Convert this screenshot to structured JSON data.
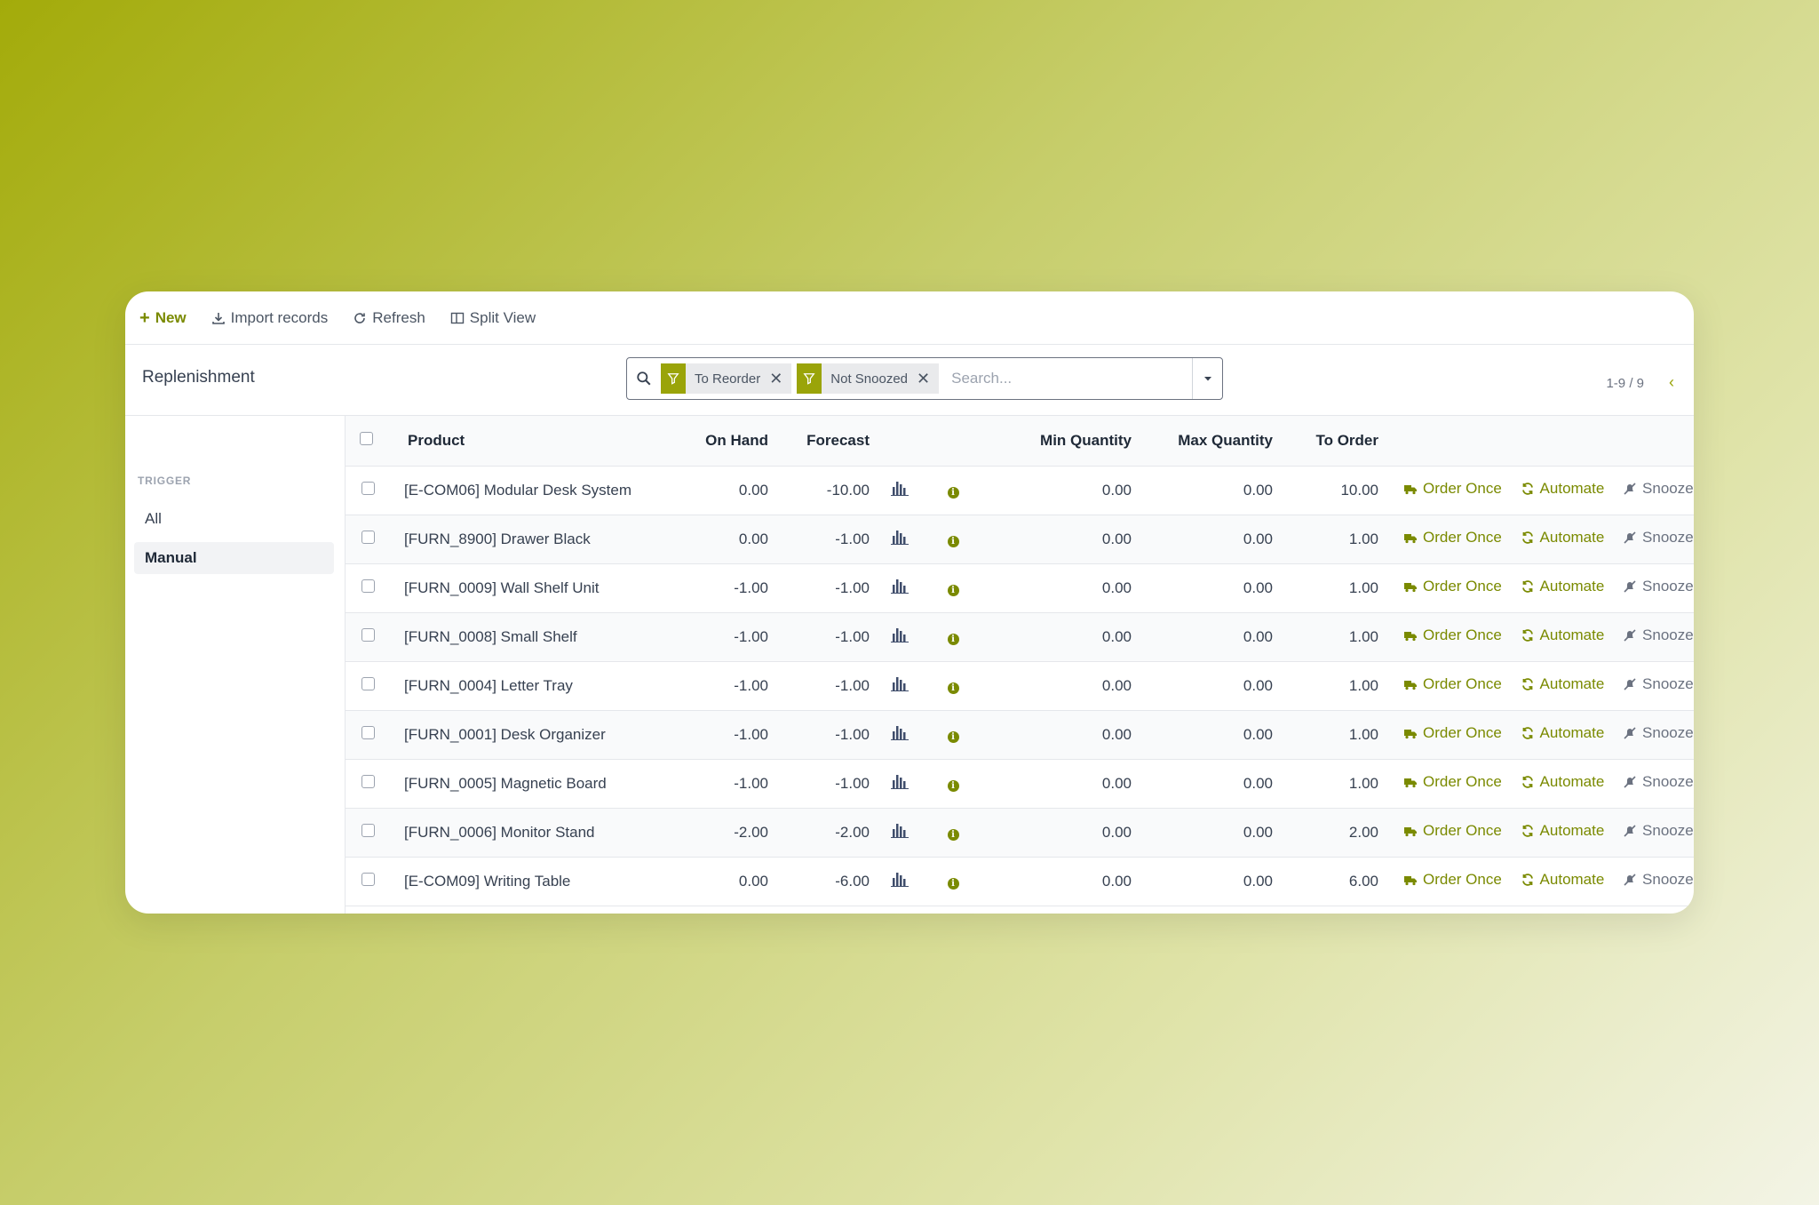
{
  "colors": {
    "accent": "#7a8a00",
    "facet": "#9aa409"
  },
  "toolbar": {
    "new_label": "New",
    "import_label": "Import records",
    "refresh_label": "Refresh",
    "split_label": "Split View"
  },
  "breadcrumb": "Replenishment",
  "search": {
    "facets": [
      "To Reorder",
      "Not Snoozed"
    ],
    "placeholder": "Search..."
  },
  "pager": "1-9 / 9",
  "sidebar": {
    "title": "TRIGGER",
    "items": [
      {
        "label": "All",
        "active": false
      },
      {
        "label": "Manual",
        "active": true
      }
    ]
  },
  "table": {
    "headers": {
      "product": "Product",
      "on_hand": "On Hand",
      "forecast": "Forecast",
      "min_qty": "Min Quantity",
      "max_qty": "Max Quantity",
      "to_order": "To Order"
    },
    "actions": {
      "order_once": "Order Once",
      "automate": "Automate",
      "snooze": "Snooze"
    },
    "rows": [
      {
        "product": "[E-COM06] Modular Desk System",
        "on_hand": "0.00",
        "forecast": "-10.00",
        "min": "0.00",
        "max": "0.00",
        "to_order": "10.00"
      },
      {
        "product": "[FURN_8900] Drawer Black",
        "on_hand": "0.00",
        "forecast": "-1.00",
        "min": "0.00",
        "max": "0.00",
        "to_order": "1.00"
      },
      {
        "product": "[FURN_0009] Wall Shelf Unit",
        "on_hand": "-1.00",
        "forecast": "-1.00",
        "min": "0.00",
        "max": "0.00",
        "to_order": "1.00"
      },
      {
        "product": "[FURN_0008] Small Shelf",
        "on_hand": "-1.00",
        "forecast": "-1.00",
        "min": "0.00",
        "max": "0.00",
        "to_order": "1.00"
      },
      {
        "product": "[FURN_0004] Letter Tray",
        "on_hand": "-1.00",
        "forecast": "-1.00",
        "min": "0.00",
        "max": "0.00",
        "to_order": "1.00"
      },
      {
        "product": "[FURN_0001] Desk Organizer",
        "on_hand": "-1.00",
        "forecast": "-1.00",
        "min": "0.00",
        "max": "0.00",
        "to_order": "1.00"
      },
      {
        "product": "[FURN_0005] Magnetic Board",
        "on_hand": "-1.00",
        "forecast": "-1.00",
        "min": "0.00",
        "max": "0.00",
        "to_order": "1.00"
      },
      {
        "product": "[FURN_0006] Monitor Stand",
        "on_hand": "-2.00",
        "forecast": "-2.00",
        "min": "0.00",
        "max": "0.00",
        "to_order": "2.00"
      },
      {
        "product": "[E-COM09] Writing Table",
        "on_hand": "0.00",
        "forecast": "-6.00",
        "min": "0.00",
        "max": "0.00",
        "to_order": "6.00"
      }
    ]
  }
}
